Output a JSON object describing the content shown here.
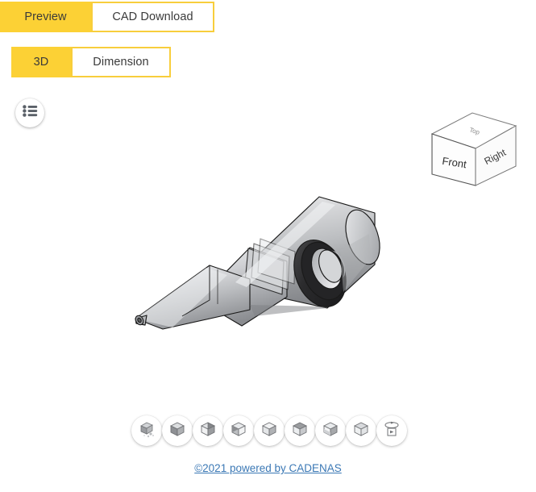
{
  "app": {
    "accent_yellow": "#FCD135",
    "accent_yellow_border": "#F8CE3C",
    "tab_text_color": "#3a3a3a",
    "footer_link_color": "#3b78b5",
    "viewer_background": "#ffffff"
  },
  "tabs_main": [
    {
      "label": "Preview",
      "state": "active",
      "name": "tab-preview"
    },
    {
      "label": "CAD Download",
      "state": "inactive",
      "name": "tab-cad-download"
    }
  ],
  "tabs_sub": [
    {
      "label": "3D",
      "state": "active",
      "name": "tab-3d"
    },
    {
      "label": "Dimension",
      "state": "inactive",
      "name": "tab-dimension"
    }
  ],
  "viewer": {
    "menu_button_icon": "list-menu-icon",
    "nav_cube": {
      "faces": {
        "front": "Front",
        "right": "Right",
        "top": "Top"
      }
    },
    "model": {
      "description": "conical nozzle tip with dark sealing ring",
      "body_color": "#c8c9cb",
      "highlight_color": "#e9eaec",
      "shadow_color": "#8e9094",
      "ring_color": "#2e2e30",
      "outline_color": "#111111"
    }
  },
  "view_toolbar": [
    {
      "label": "Exploded view",
      "icon": "exploded-cube-icon",
      "name": "tool-exploded-view"
    },
    {
      "label": "Isometric view",
      "icon": "cube-solid-icon",
      "name": "tool-isometric-view"
    },
    {
      "label": "Section view",
      "icon": "cube-section-icon",
      "name": "tool-section-view"
    },
    {
      "label": "Front view",
      "icon": "cube-front-icon",
      "name": "tool-front-view"
    },
    {
      "label": "Back view",
      "icon": "cube-back-icon",
      "name": "tool-back-view"
    },
    {
      "label": "Left view",
      "icon": "cube-left-icon",
      "name": "tool-left-view"
    },
    {
      "label": "Right view",
      "icon": "cube-right-icon",
      "name": "tool-right-view"
    },
    {
      "label": "Top view",
      "icon": "cube-top-icon",
      "name": "tool-top-view"
    },
    {
      "label": "Turntable rotate",
      "icon": "rotate-animation-icon",
      "name": "tool-turntable-rotate"
    }
  ],
  "footer": {
    "link_text": "©2021 powered by CADENAS"
  }
}
